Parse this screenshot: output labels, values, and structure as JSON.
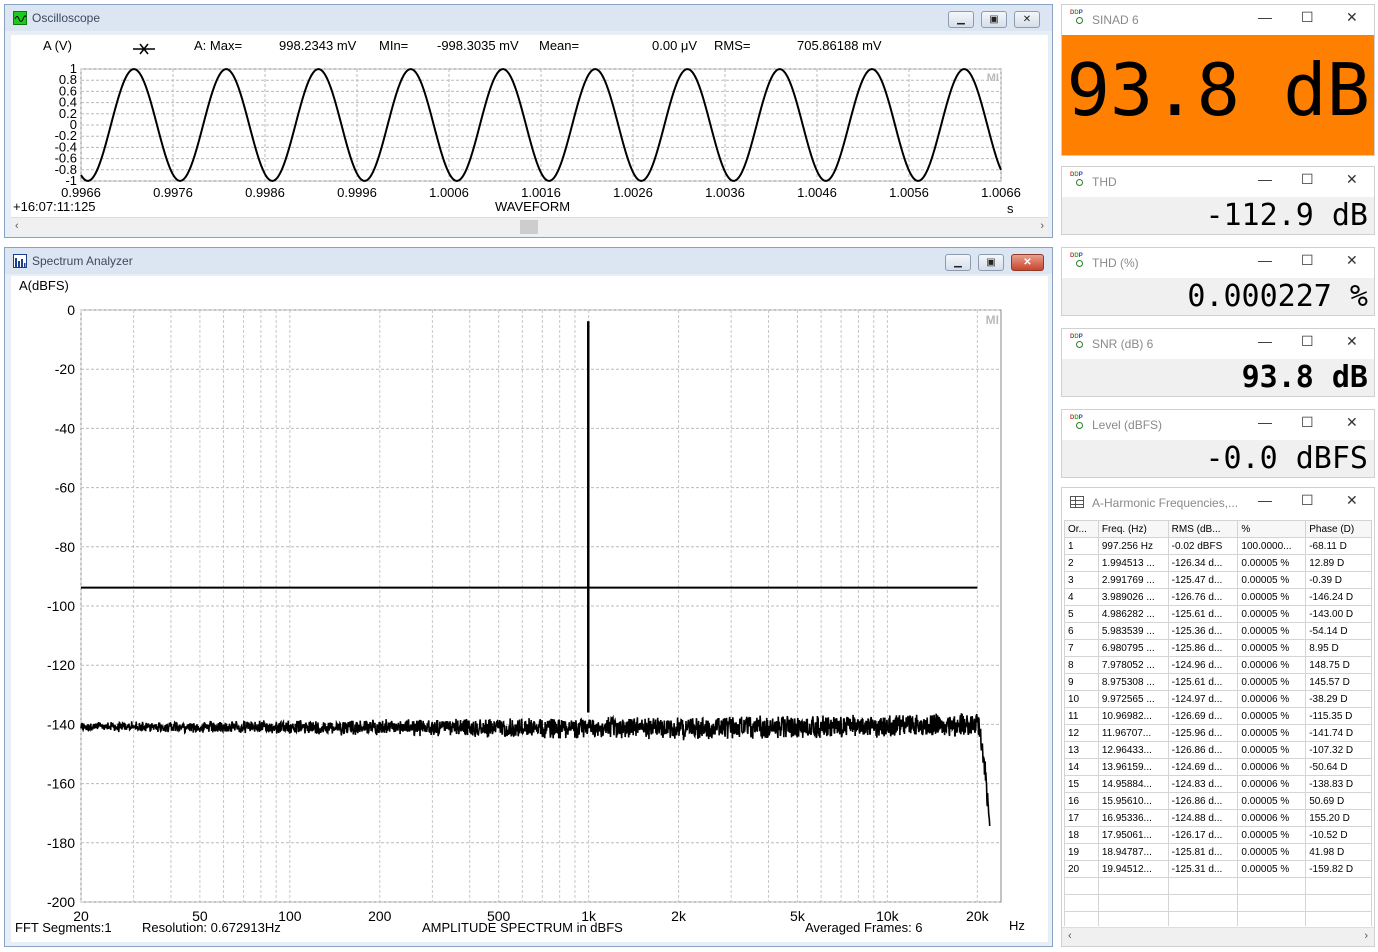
{
  "oscilloscope": {
    "title": "Oscilloscope",
    "ylabel": "A (V)",
    "stats": {
      "max_label": "A: Max=",
      "max": "998.2343 mV",
      "min_label": "MIn=",
      "min": "-998.3035 mV",
      "mean_label": "Mean=",
      "mean": "0.00  μV",
      "rms_label": "RMS=",
      "rms": "705.86188 mV"
    },
    "timestamp": "+16:07:11:125",
    "xtitle": "WAVEFORM",
    "xunit": "s",
    "watermark": "MI"
  },
  "spectrum": {
    "title": "Spectrum Analyzer",
    "ylabel": "A(dBFS)",
    "xunit": "Hz",
    "watermark": "MI",
    "footer": {
      "segments": "FFT Segments:1",
      "resolution": "Resolution: 0.672913Hz",
      "center": "AMPLITUDE SPECTRUM in dBFS",
      "frames": "Averaged Frames: 6"
    }
  },
  "meters": [
    {
      "name": "SINAD  6",
      "value": "93.8 dB",
      "highlight": "#ff7f00"
    },
    {
      "name": "THD",
      "value": "-112.9 dB"
    },
    {
      "name": "THD (%)",
      "value": "0.000227 %"
    },
    {
      "name": "SNR (dB)  6",
      "value": "93.8 dB"
    },
    {
      "name": "Level (dBFS)",
      "value": "-0.0 dBFS"
    }
  ],
  "harmonics": {
    "title": "A-Harmonic Frequencies,...",
    "columns": [
      "Or...",
      "Freq. (Hz)",
      "RMS (dB...",
      "%",
      "Phase (D)"
    ],
    "rows": [
      [
        "1",
        "997.256 Hz",
        "-0.02 dBFS",
        "100.0000...",
        "-68.11  D"
      ],
      [
        "2",
        "1.994513 ...",
        "-126.34 d...",
        "0.00005  %",
        "12.89  D"
      ],
      [
        "3",
        "2.991769 ...",
        "-125.47 d...",
        "0.00005  %",
        "-0.39  D"
      ],
      [
        "4",
        "3.989026 ...",
        "-126.76 d...",
        "0.00005  %",
        "-146.24  D"
      ],
      [
        "5",
        "4.986282 ...",
        "-125.61 d...",
        "0.00005  %",
        "-143.00  D"
      ],
      [
        "6",
        "5.983539 ...",
        "-125.36 d...",
        "0.00005  %",
        "-54.14  D"
      ],
      [
        "7",
        "6.980795 ...",
        "-125.86 d...",
        "0.00005  %",
        "8.95  D"
      ],
      [
        "8",
        "7.978052 ...",
        "-124.96 d...",
        "0.00006  %",
        "148.75  D"
      ],
      [
        "9",
        "8.975308 ...",
        "-125.61 d...",
        "0.00005  %",
        "145.57  D"
      ],
      [
        "10",
        "9.972565 ...",
        "-124.97 d...",
        "0.00006  %",
        "-38.29  D"
      ],
      [
        "11",
        "10.96982...",
        "-126.69 d...",
        "0.00005  %",
        "-115.35  D"
      ],
      [
        "12",
        "11.96707...",
        "-125.96 d...",
        "0.00005  %",
        "-141.74  D"
      ],
      [
        "13",
        "12.96433...",
        "-126.86 d...",
        "0.00005  %",
        "-107.32  D"
      ],
      [
        "14",
        "13.96159...",
        "-124.69 d...",
        "0.00006  %",
        "-50.64  D"
      ],
      [
        "15",
        "14.95884...",
        "-124.83 d...",
        "0.00006  %",
        "-138.83  D"
      ],
      [
        "16",
        "15.95610...",
        "-126.86 d...",
        "0.00005  %",
        "50.69  D"
      ],
      [
        "17",
        "16.95336...",
        "-124.88 d...",
        "0.00006  %",
        "155.20  D"
      ],
      [
        "18",
        "17.95061...",
        "-126.17 d...",
        "0.00005  %",
        "-10.52  D"
      ],
      [
        "19",
        "18.94787...",
        "-125.81 d...",
        "0.00005  %",
        "41.98  D"
      ],
      [
        "20",
        "19.94512...",
        "-125.31 d...",
        "0.00005  %",
        "-159.82  D"
      ]
    ]
  },
  "chart_data": [
    {
      "type": "line",
      "ylabel": "A (V)",
      "xlabel": "WAVEFORM",
      "ylim": [
        -1,
        1
      ],
      "xlim": [
        0.9966,
        1.0066
      ],
      "yticks": [
        "1",
        "0.8",
        "0.6",
        "0.4",
        "0.2",
        "0",
        "-0.2",
        "-0.4",
        "-0.6",
        "-0.8",
        "-1"
      ],
      "xticks": [
        "0.9966",
        "0.9976",
        "0.9986",
        "0.9996",
        "1.0006",
        "1.0016",
        "1.0026",
        "1.0036",
        "1.0046",
        "1.0056",
        "1.0066"
      ],
      "series": [
        {
          "frequency_hz": 997.256,
          "amplitude_v": 0.998,
          "phase_deg": -68.11
        }
      ],
      "grid": true
    },
    {
      "type": "line",
      "ylabel": "A(dBFS)",
      "xlabel": "AMPLITUDE SPECTRUM in dBFS",
      "xscale": "log",
      "xlim": [
        20,
        24000
      ],
      "ylim": [
        -200,
        0
      ],
      "yticks": [
        "0",
        "-20",
        "-40",
        "-60",
        "-80",
        "-100",
        "-120",
        "-140",
        "-160",
        "-180",
        "-200"
      ],
      "xticks": [
        {
          "v": 20,
          "t": "20"
        },
        {
          "v": 50,
          "t": "50"
        },
        {
          "v": 100,
          "t": "100"
        },
        {
          "v": 200,
          "t": "200"
        },
        {
          "v": 500,
          "t": "500"
        },
        {
          "v": 1000,
          "t": "1k"
        },
        {
          "v": 2000,
          "t": "2k"
        },
        {
          "v": 5000,
          "t": "5k"
        },
        {
          "v": 10000,
          "t": "10k"
        },
        {
          "v": 20000,
          "t": "20k"
        }
      ],
      "fundamental": {
        "freq": 997.256,
        "level": -3.8
      },
      "threshold_line": {
        "level": -93.8,
        "from": 20,
        "to": 20000
      },
      "noise_floor": {
        "level_low": -140,
        "level_high": -137,
        "rolloff_start": 20000,
        "rolloff_end": 22000,
        "rolloff_level": -171
      },
      "grid": true
    }
  ]
}
